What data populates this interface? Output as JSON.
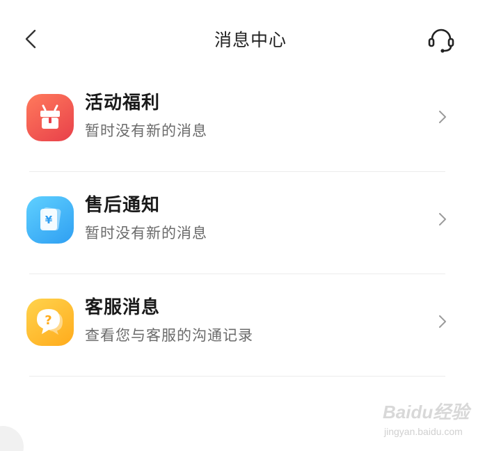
{
  "header": {
    "title": "消息中心",
    "back_icon": "chevron-left-icon",
    "service_icon": "headset-icon"
  },
  "messages": [
    {
      "title": "活动福利",
      "subtitle": "暂时没有新的消息",
      "icon": "gift-icon",
      "color": "#ef5350"
    },
    {
      "title": "售后通知",
      "subtitle": "暂时没有新的消息",
      "icon": "yuan-document-icon",
      "color": "#3aa8f5"
    },
    {
      "title": "客服消息",
      "subtitle": "查看您与客服的沟通记录",
      "icon": "question-chat-icon",
      "color": "#ffb826"
    }
  ],
  "watermark": {
    "logo": "Baidu经验",
    "url": "jingyan.baidu.com"
  }
}
